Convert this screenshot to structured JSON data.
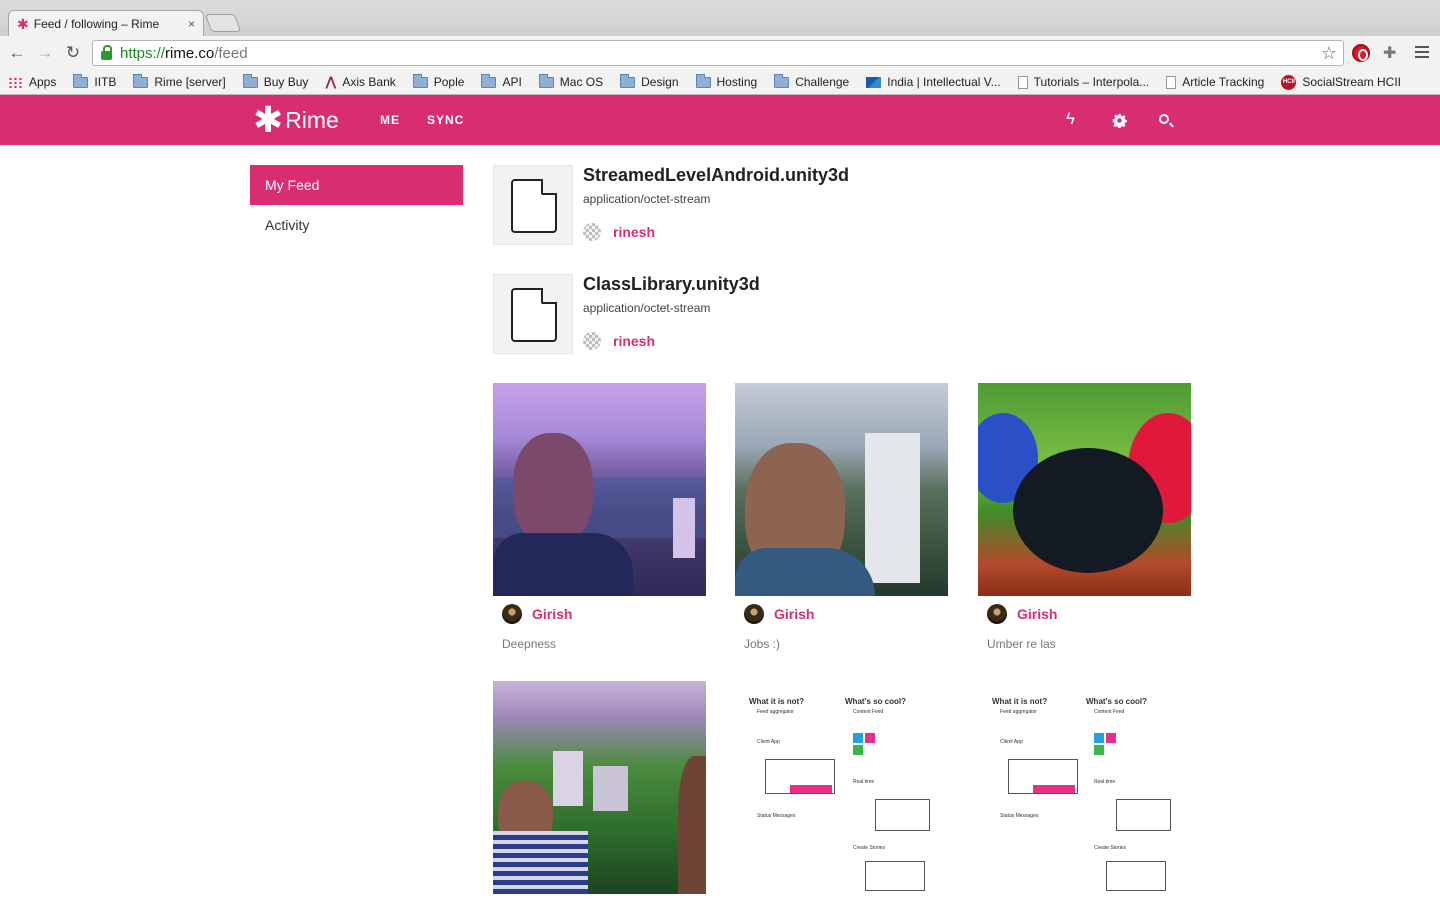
{
  "browser": {
    "tab_title": "Feed / following – Rime",
    "tab_close": "×",
    "url_scheme": "https://",
    "url_host": "rime.co",
    "url_path": "/feed",
    "bookmarks": [
      "Apps",
      "IITB",
      "Rime [server]",
      "Buy Buy",
      "Axis Bank",
      "Pople",
      "API",
      "Mac OS",
      "Design",
      "Hosting",
      "Challenge",
      "India | Intellectual V...",
      "Tutorials – Interpola...",
      "Article Tracking",
      "SocialStream HCII"
    ]
  },
  "header": {
    "logo_text": "Rime",
    "nav": [
      "ME",
      "SYNC"
    ],
    "icons": [
      "lightning-icon",
      "gear-icon",
      "search-icon"
    ],
    "brand_color": "#d92d72"
  },
  "sidebar": {
    "items": [
      {
        "label": "My Feed",
        "active": true
      },
      {
        "label": "Activity",
        "active": false
      }
    ]
  },
  "feed": {
    "files": [
      {
        "name": "StreamedLevelAndroid.unity3d",
        "type": "application/octet-stream",
        "user": "rinesh"
      },
      {
        "name": "ClassLibrary.unity3d",
        "type": "application/octet-stream",
        "user": "rinesh"
      }
    ],
    "photos": [
      {
        "user": "Girish",
        "caption": "Deepness"
      },
      {
        "user": "Girish",
        "caption": "Jobs :)"
      },
      {
        "user": "Girish",
        "caption": "Umber re las"
      }
    ],
    "sheet": {
      "left_title": "What it is not?",
      "right_title": "What's so cool?",
      "left_items": [
        "Feed aggregator",
        "Client App",
        "Status Messages"
      ],
      "right_items": [
        "Content Feed",
        "Real time",
        "Create Stories"
      ]
    }
  }
}
